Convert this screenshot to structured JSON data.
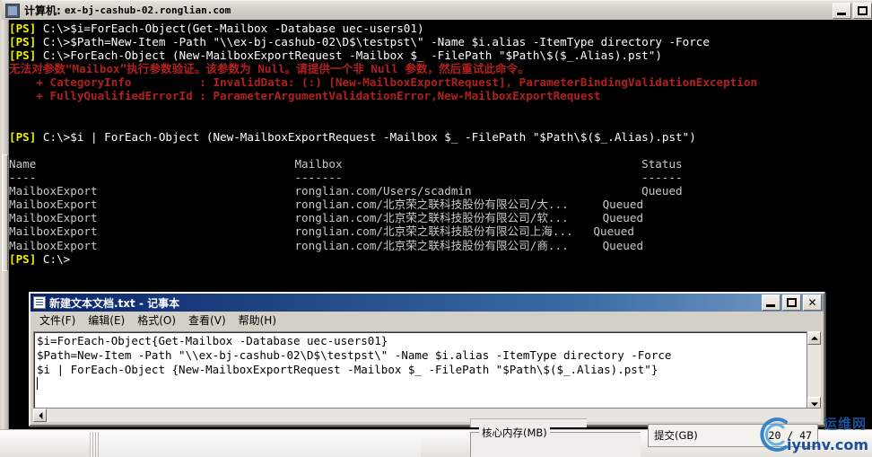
{
  "powershell_window": {
    "title_prefix": "计算机:",
    "title_host": "ex-bj-cashub-02.ronglian.com",
    "icon": "powershell-icon",
    "buttons": {
      "minimize": "_",
      "maximize": "□",
      "close": "✕"
    },
    "console_lines": [
      {
        "type": "prompt",
        "prompt": "[PS]",
        "text": " C:\\>$i=ForEach-Object(Get-Mailbox -Database uec-users01)"
      },
      {
        "type": "prompt",
        "prompt": "[PS]",
        "text": " C:\\>$Path=New-Item -Path \"\\\\ex-bj-cashub-02\\D$\\testpst\\\" -Name $i.alias -ItemType directory -Force"
      },
      {
        "type": "prompt",
        "prompt": "[PS]",
        "text": " C:\\>ForEach-Object (New-MailboxExportRequest -Mailbox $_ -FilePath \"$Path\\$($_.Alias).pst\")"
      },
      {
        "type": "error",
        "text": "无法对参数“Mailbox”执行参数验证。该参数为 Null。请提供一个非 Null 参数，然后重试此命令。"
      },
      {
        "type": "error",
        "text": "    + CategoryInfo          : InvalidData: (:) [New-MailboxExportRequest], ParameterBindingValidationException"
      },
      {
        "type": "error",
        "text": "    + FullyQualifiedErrorId : ParameterArgumentValidationError,New-MailboxExportRequest"
      },
      {
        "type": "blank",
        "text": " "
      },
      {
        "type": "blank",
        "text": " "
      },
      {
        "type": "prompt",
        "prompt": "[PS]",
        "text": " C:\\>$i | ForEach-Object (New-MailboxExportRequest -Mailbox $_ -FilePath \"$Path\\$($_.Alias).pst\")"
      },
      {
        "type": "blank",
        "text": " "
      },
      {
        "type": "table-header",
        "text": "Name                                      Mailbox                                            Status"
      },
      {
        "type": "table-rule",
        "text": "----                                      -------                                            ------"
      },
      {
        "type": "table",
        "text": "MailboxExport                             ronglian.com/Users/scadmin                         Queued"
      },
      {
        "type": "table",
        "text": "MailboxExport                             ronglian.com/北京荣之联科技股份有限公司/大...     Queued"
      },
      {
        "type": "table",
        "text": "MailboxExport                             ronglian.com/北京荣之联科技股份有限公司/软...     Queued"
      },
      {
        "type": "table",
        "text": "MailboxExport                             ronglian.com/北京荣之联科技股份有限公司上海...   Queued"
      },
      {
        "type": "table",
        "text": "MailboxExport                             ronglian.com/北京荣之联科技股份有限公司/商...     Queued"
      },
      {
        "type": "prompt",
        "prompt": "[PS]",
        "text": " C:\\>"
      }
    ]
  },
  "notepad_window": {
    "title": "新建文本文档.txt - 记事本",
    "icon": "notepad-icon",
    "buttons": {
      "minimize": "_",
      "maximize": "□",
      "close": "✕"
    },
    "menu": [
      {
        "label": "文件(F)"
      },
      {
        "label": "编辑(E)"
      },
      {
        "label": "格式(O)"
      },
      {
        "label": "查看(V)"
      },
      {
        "label": "帮助(H)"
      }
    ],
    "text_lines": [
      "$i=ForEach-Object{Get-Mailbox -Database uec-users01}",
      "$Path=New-Item -Path \"\\\\ex-bj-cashub-02\\D$\\testpst\\\" -Name $i.alias -ItemType directory -Force",
      "$i | ForEach-Object {New-MailboxExportRequest -Mailbox $_ -FilePath \"$Path\\$($_.Alias).pst\"}"
    ]
  },
  "taskmanager_strip": {
    "kernel_memory_label": "核心内存(MB)",
    "commit_label": "提交(GB)",
    "commit_value": "20 / 47"
  },
  "watermark": {
    "cn_text": "运维网",
    "en_text": "iyunv.com",
    "color": "#1b4f9c",
    "icon": "swoosh-logo-icon"
  },
  "colors": {
    "console_background": "#000000",
    "prompt_yellow": "#f0f000",
    "command_white": "#ffffff",
    "error_red": "#b02020",
    "titlebar_blue": "#0a246a",
    "chrome_gray": "#d4d0c8"
  }
}
